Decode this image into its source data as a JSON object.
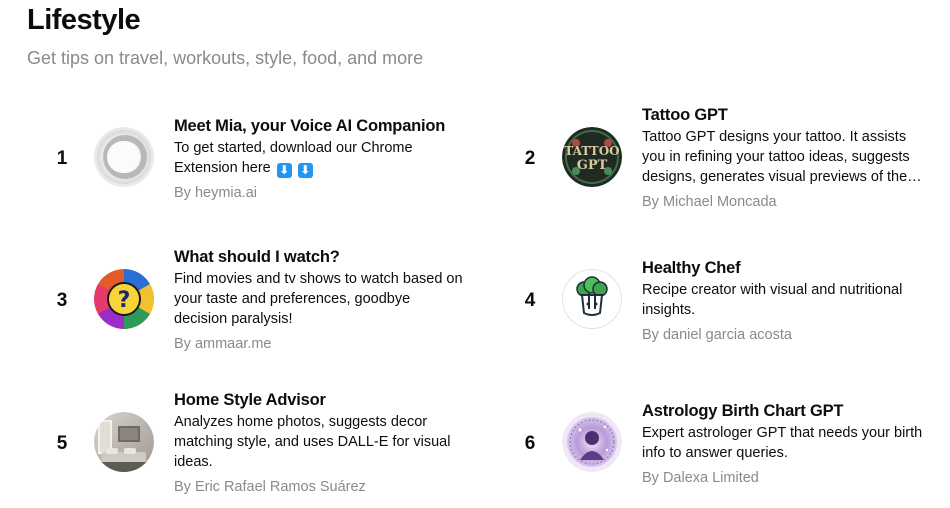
{
  "header": {
    "title": "Lifestyle",
    "subtitle": "Get tips on travel, workouts, style, food, and more"
  },
  "items": [
    {
      "rank": "1",
      "name": "Meet Mia, your Voice AI Companion",
      "description": "To get started, download our Chrome Extension here",
      "badges": [
        "⬇",
        "⬇"
      ],
      "author": "By heymia.ai",
      "icon": "mia-ring-icon"
    },
    {
      "rank": "2",
      "name": "Tattoo GPT",
      "description": "Tattoo GPT designs your tattoo. It assists you in refining your tattoo ideas, suggests designs, generates visual previews of the…",
      "author": "By Michael Moncada",
      "icon": "tattoo-gpt-logo-icon",
      "logo_text": "TATTOO GPT"
    },
    {
      "rank": "3",
      "name": "What should I watch?",
      "description": "Find movies and tv shows to watch based on your taste and preferences, goodbye decision paralysis!",
      "author": "By ammaar.me",
      "icon": "question-mark-icon",
      "logo_text": "?"
    },
    {
      "rank": "4",
      "name": "Healthy Chef",
      "description": "Recipe creator with visual and nutritional insights.",
      "author": "By daniel garcia acosta",
      "icon": "chef-hat-broccoli-icon"
    },
    {
      "rank": "5",
      "name": "Home Style Advisor",
      "description": "Analyzes home photos, suggests decor matching style, and uses DALL-E for visual ideas.",
      "author": "By Eric Rafael Ramos Suárez",
      "icon": "living-room-photo-icon"
    },
    {
      "rank": "6",
      "name": "Astrology Birth Chart GPT",
      "description": "Expert astrologer GPT that needs your birth info to answer queries.",
      "author": "By Dalexa Limited",
      "icon": "astrology-portrait-icon"
    }
  ],
  "colors": {
    "muted": "#8a8a8a",
    "text": "#0d0d0d",
    "badge": "#2196f3"
  }
}
